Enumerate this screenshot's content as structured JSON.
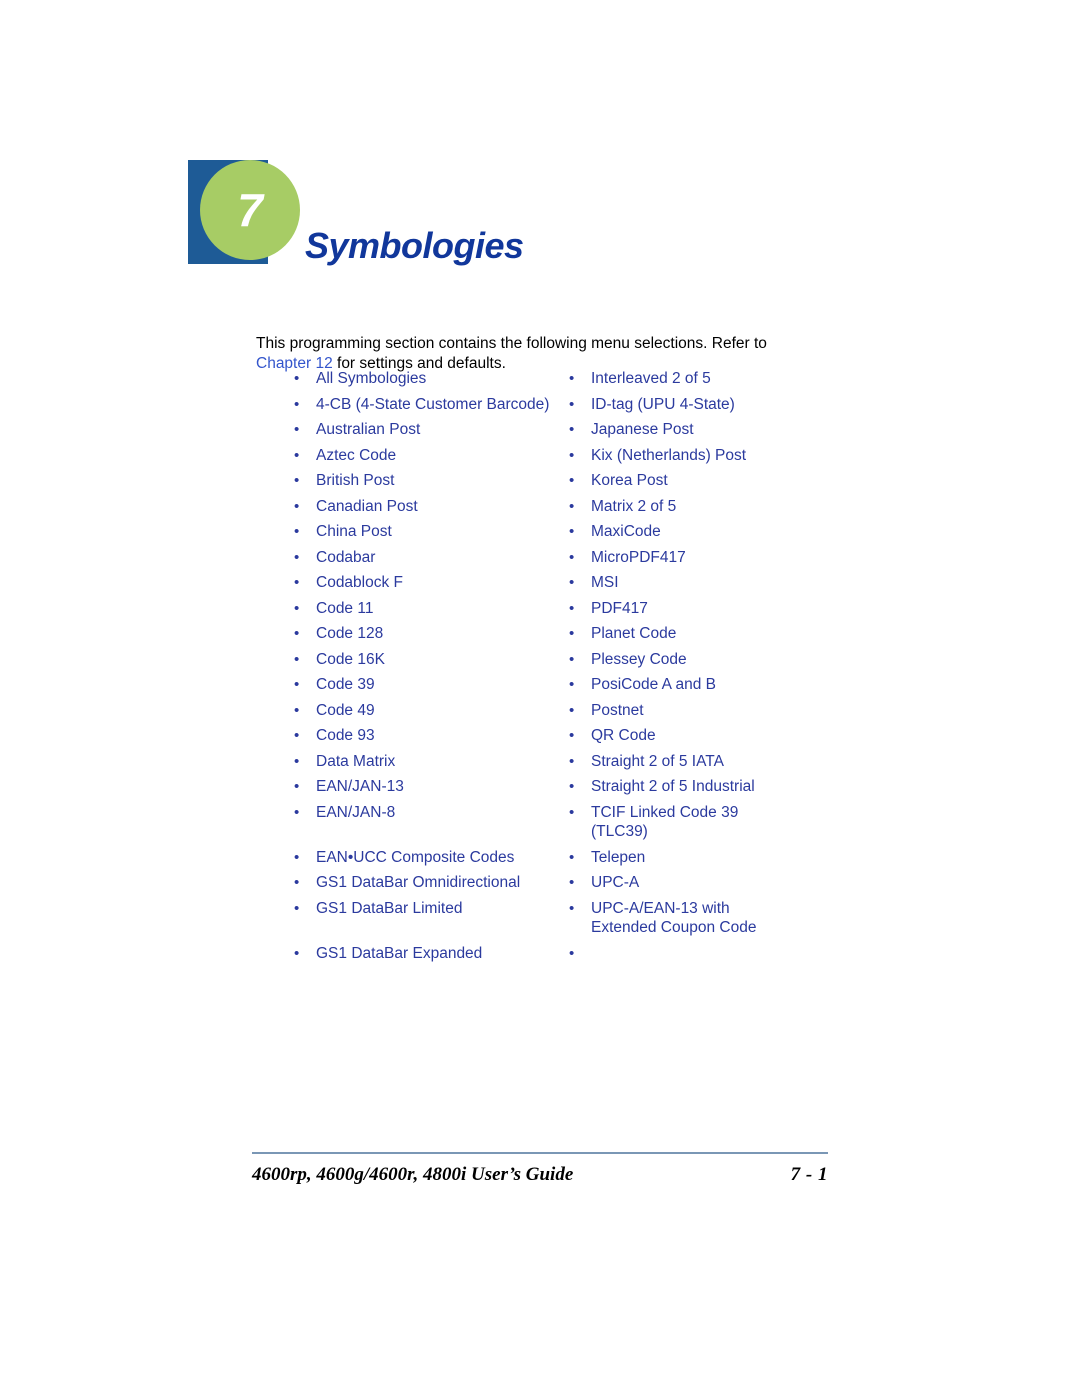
{
  "chapter": {
    "number": "7",
    "title": "Symbologies",
    "square_color": "#1E5B96",
    "circle_color": "#A7CC65",
    "title_color": "#11379B"
  },
  "intro": {
    "text_before_link": "This programming section contains the following menu selections.  Refer to ",
    "link_text": "Chapter 12",
    "text_after_link": " for settings and defaults.",
    "link_color": "#3355CC"
  },
  "list": {
    "bullet_glyph": "•",
    "link_color": "#2B3A9E",
    "rows": [
      {
        "left": "All Symbologies",
        "right": "Interleaved 2 of 5"
      },
      {
        "left": "4-CB (4-State Customer Barcode)",
        "right": "ID-tag (UPU 4-State)"
      },
      {
        "left": "Australian Post",
        "right": "Japanese Post"
      },
      {
        "left": "Aztec Code",
        "right": "Kix (Netherlands) Post"
      },
      {
        "left": "British Post",
        "right": "Korea Post"
      },
      {
        "left": "Canadian Post",
        "right": "Matrix 2 of 5"
      },
      {
        "left": "China Post",
        "right": "MaxiCode"
      },
      {
        "left": "Codabar",
        "right": "MicroPDF417"
      },
      {
        "left": "Codablock F",
        "right": "MSI"
      },
      {
        "left": "Code 11",
        "right": "PDF417"
      },
      {
        "left": "Code 128",
        "right": "Planet Code"
      },
      {
        "left": "Code 16K",
        "right": "Plessey Code"
      },
      {
        "left": "Code 39",
        "right": "PosiCode A and B"
      },
      {
        "left": "Code 49",
        "right": "Postnet"
      },
      {
        "left": "Code 93",
        "right": "QR Code"
      },
      {
        "left": "Data Matrix",
        "right": "Straight 2 of 5 IATA"
      },
      {
        "left": "EAN/JAN-13",
        "right": "Straight 2 of 5 Industrial"
      },
      {
        "left": "EAN/JAN-8",
        "right": "TCIF Linked Code 39 (TLC39)"
      },
      {
        "left": "EAN•UCC Composite Codes",
        "right": "Telepen"
      },
      {
        "left": "GS1 DataBar Omnidirectional",
        "right": "UPC-A"
      },
      {
        "left": "GS1 DataBar Limited",
        "right": "UPC-A/EAN-13 with Extended Coupon Code"
      },
      {
        "left": "GS1 DataBar Expanded",
        "right": ""
      }
    ]
  },
  "footer": {
    "guide_title": "4600rp, 4600g/4600r, 4800i User’s Guide",
    "page_number": "7 - 1",
    "rule_color": "#7A97B5"
  }
}
